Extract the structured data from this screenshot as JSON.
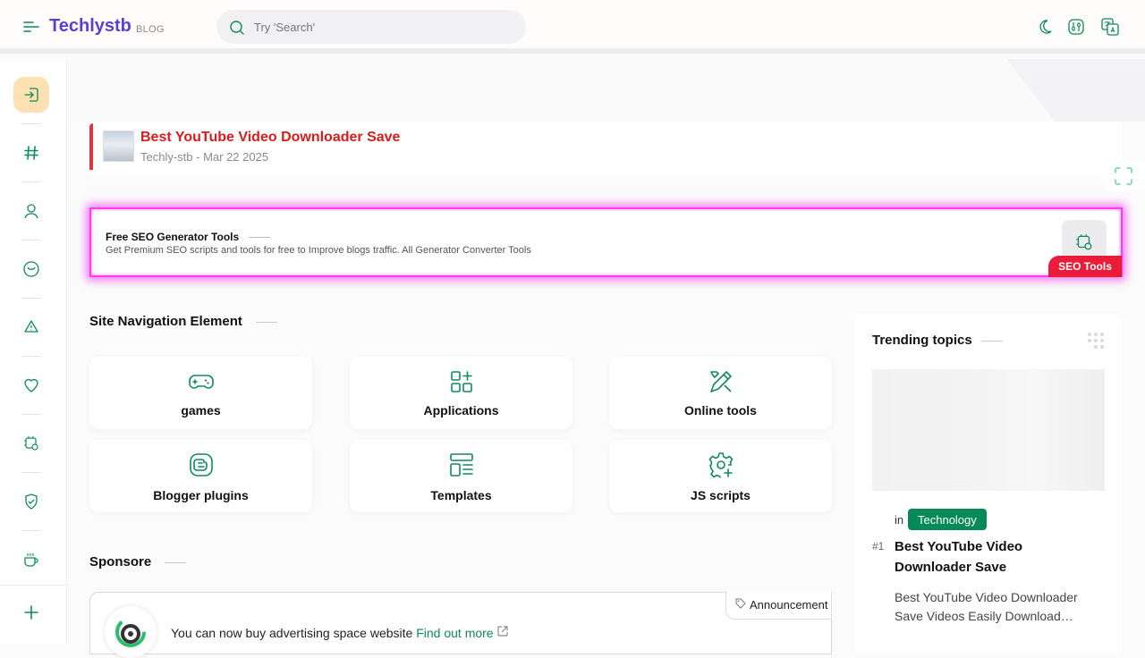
{
  "header": {
    "logo": "Techlystb",
    "logo_sub": "BLOG",
    "search_placeholder": "Try 'Search'"
  },
  "post": {
    "title": "Best YouTube Video Downloader Save",
    "meta": "Techly-stb - Mar 22 2025"
  },
  "seo_card": {
    "title": "Free SEO Generator Tools",
    "description": "Get Premium SEO scripts and tools for free to Improve blogs traffic. All Generator Converter Tools",
    "badge": "SEO Tools"
  },
  "site_nav": {
    "title": "Site Navigation Element",
    "items": [
      {
        "label": "games",
        "icon": "gamepad-icon"
      },
      {
        "label": "Applications",
        "icon": "apps-grid-icon"
      },
      {
        "label": "Online tools",
        "icon": "tools-icon"
      },
      {
        "label": "Blogger plugins",
        "icon": "blogger-icon"
      },
      {
        "label": "Templates",
        "icon": "template-icon"
      },
      {
        "label": "JS scripts",
        "icon": "settings-plus-icon"
      }
    ]
  },
  "sponsor": {
    "title": "Sponsore",
    "announcement": "Announcement",
    "text": "You can now buy advertising space website",
    "link": "Find out more"
  },
  "trending": {
    "title": "Trending topics",
    "in_label": "in",
    "category": "Technology",
    "rank": "#1",
    "post_title": "Best YouTube Video Downloader Save",
    "snippet": "Best YouTube Video Downloader Save Videos Easily Download…"
  },
  "colors": {
    "accent_green": "#078a5a",
    "logo_purple": "#5a3fd6",
    "post_red": "#d91c1c",
    "seo_glow": "#ff3bf2",
    "badge_red": "#ea1c39"
  }
}
